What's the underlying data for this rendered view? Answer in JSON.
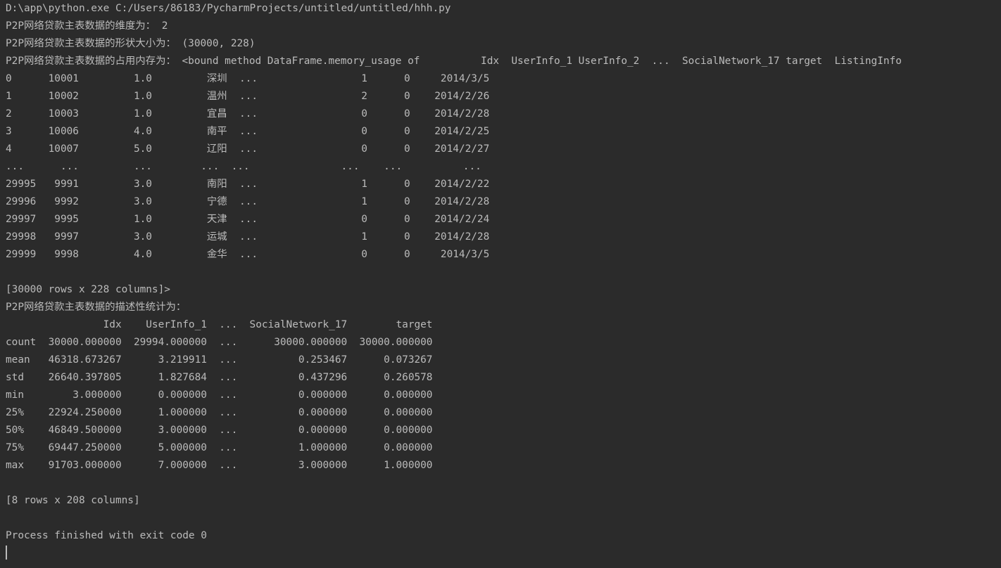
{
  "console": {
    "command": "D:\\app\\python.exe C:/Users/86183/PycharmProjects/untitled/untitled/hhh.py",
    "lines": [
      "P2P网络贷款主表数据的维度为： 2",
      "P2P网络贷款主表数据的形状大小为： (30000, 228)",
      "P2P网络贷款主表数据的占用内存为： <bound method DataFrame.memory_usage of          Idx  UserInfo_1 UserInfo_2  ...  SocialNetwork_17 target  ListingInfo",
      "0      10001         1.0         深圳  ...                 1      0     2014/3/5",
      "1      10002         1.0         温州  ...                 2      0    2014/2/26",
      "2      10003         1.0         宜昌  ...                 0      0    2014/2/28",
      "3      10006         4.0         南平  ...                 0      0    2014/2/25",
      "4      10007         5.0         辽阳  ...                 0      0    2014/2/27",
      "...      ...         ...        ...  ...               ...    ...          ...",
      "29995   9991         3.0         南阳  ...                 1      0    2014/2/22",
      "29996   9992         3.0         宁德  ...                 1      0    2014/2/28",
      "29997   9995         1.0         天津  ...                 0      0    2014/2/24",
      "29998   9997         3.0         运城  ...                 1      0    2014/2/28",
      "29999   9998         4.0         金华  ...                 0      0     2014/3/5",
      "",
      "[30000 rows x 228 columns]>",
      "P2P网络贷款主表数据的描述性统计为：",
      "                Idx    UserInfo_1  ...  SocialNetwork_17        target",
      "count  30000.000000  29994.000000  ...      30000.000000  30000.000000",
      "mean   46318.673267      3.219911  ...          0.253467      0.073267",
      "std    26640.397805      1.827684  ...          0.437296      0.260578",
      "min        3.000000      0.000000  ...          0.000000      0.000000",
      "25%    22924.250000      1.000000  ...          0.000000      0.000000",
      "50%    46849.500000      3.000000  ...          0.000000      0.000000",
      "75%    69447.250000      5.000000  ...          1.000000      0.000000",
      "max    91703.000000      7.000000  ...          3.000000      1.000000",
      "",
      "[8 rows x 208 columns]",
      "",
      "Process finished with exit code 0"
    ]
  },
  "colors": {
    "background": "#2b2b2b",
    "text": "#bbbbbb"
  }
}
